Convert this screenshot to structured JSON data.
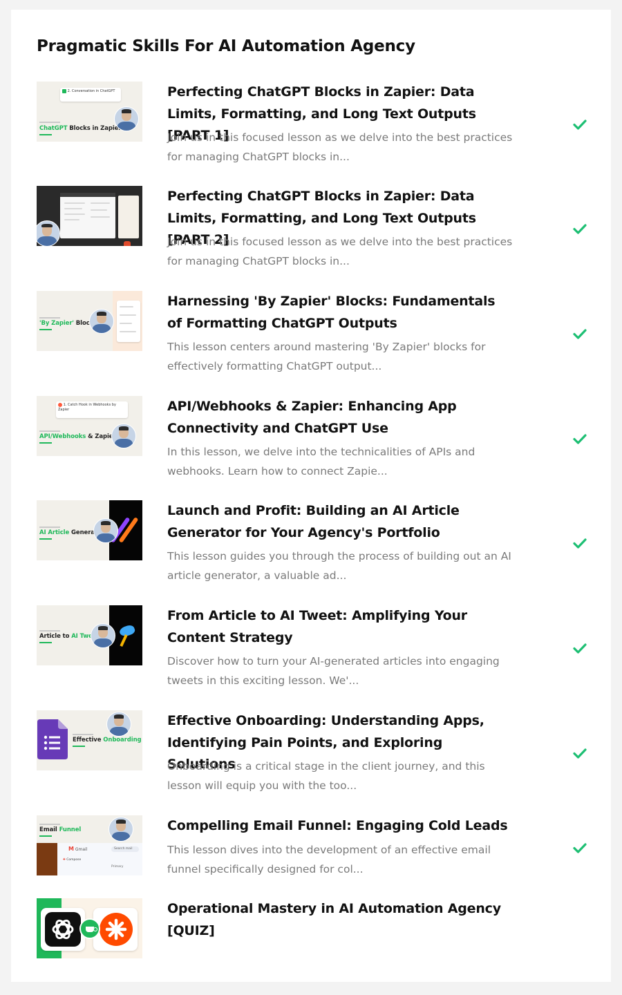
{
  "section": {
    "title": "Pragmatic Skills For AI Automation Agency"
  },
  "colors": {
    "accent_green": "#1fb85a",
    "check_green": "#1dbf73",
    "desc_gray": "#7a7a7a"
  },
  "lessons": [
    {
      "title": "Perfecting ChatGPT Blocks in Zapier: Data Limits, Formatting, and Long Text Outputs [PART 1]",
      "description": "Join us in this focused lesson as we delve into the best practices for managing ChatGPT blocks in...",
      "completed": true,
      "thumb": {
        "label_green": "ChatGPT",
        "label_dark": " Blocks in Zapier",
        "card_text": "2. Conversation in ChatGPT"
      }
    },
    {
      "title": "Perfecting ChatGPT Blocks in Zapier: Data Limits, Formatting, and Long Text Outputs [PART 2]",
      "description": "Join us in this focused lesson as we delve into the best practices for managing ChatGPT blocks in...",
      "completed": true,
      "thumb": {}
    },
    {
      "title": "Harnessing 'By Zapier' Blocks: Fundamentals of Formatting ChatGPT Outputs",
      "description": "This lesson centers around mastering 'By Zapier' blocks for effectively formatting ChatGPT output...",
      "completed": true,
      "thumb": {
        "label_green": "'By Zapier'",
        "label_dark": " Blocks"
      }
    },
    {
      "title": "API/Webhooks & Zapier: Enhancing App Connectivity and ChatGPT Use",
      "description": "In this lesson, we delve into the technicalities of APIs and webhooks. Learn how to connect Zapie...",
      "completed": true,
      "thumb": {
        "label_green": "API/Webhooks",
        "label_dark": " & Zapier",
        "card_text": "1. Catch Hook in Webhooks by Zapier"
      }
    },
    {
      "title": "Launch and Profit: Building an AI Article Generator for Your Agency's Portfolio",
      "description": "This lesson guides you through the process of building out an AI article generator, a valuable ad...",
      "completed": true,
      "thumb": {
        "label_green": "AI Article",
        "label_dark": " Generator"
      }
    },
    {
      "title": "From Article to AI Tweet: Amplifying Your Content Strategy",
      "description": "Discover how to turn your AI-generated articles into engaging tweets in this exciting lesson. We'...",
      "completed": true,
      "thumb": {
        "label_dark": "Article to ",
        "label_green": "AI Tweet"
      }
    },
    {
      "title": "Effective Onboarding: Understanding Apps, Identifying Pain Points, and Exploring Solutions",
      "description": "Onboarding is a critical stage in the client journey, and this lesson will equip you with the too...",
      "completed": true,
      "thumb": {
        "label_dark": "Effective ",
        "label_green": "Onboarding"
      }
    },
    {
      "title": "Compelling Email Funnel: Engaging Cold Leads",
      "description": "This lesson dives into the development of an effective email funnel specifically designed for col...",
      "completed": true,
      "thumb": {
        "label_dark": "Email ",
        "label_green": "Funnel",
        "mail_app": "Gmail",
        "search_text": "Search mail",
        "compose": "Compose",
        "primary": "Primary"
      }
    },
    {
      "title": "Operational Mastery in AI Automation Agency [QUIZ]",
      "description": "",
      "completed": false,
      "thumb": {}
    }
  ],
  "icons": {
    "completed": "check-icon",
    "chatgpt": "chatgpt-logo-icon",
    "zapier": "zapier-logo-icon",
    "google_forms": "google-forms-icon"
  }
}
